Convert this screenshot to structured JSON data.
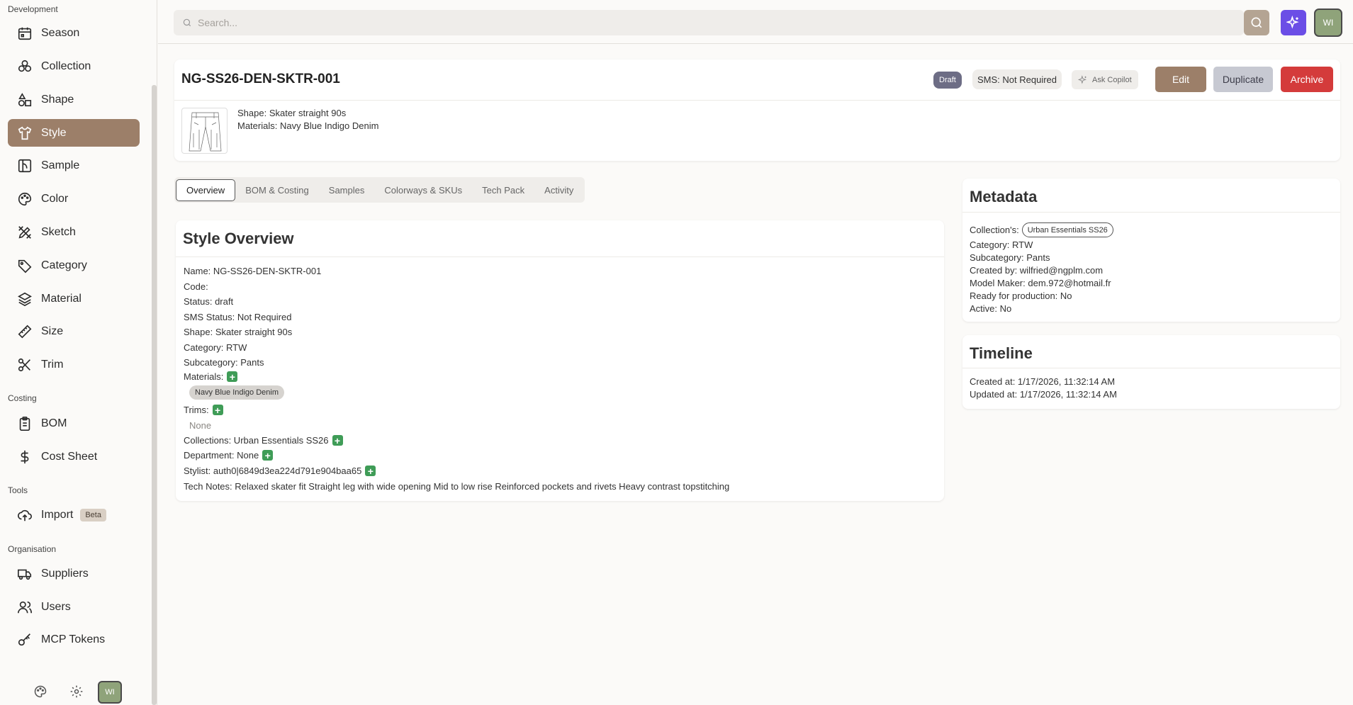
{
  "sidebar": {
    "sections": {
      "development": "Development",
      "costing": "Costing",
      "tools": "Tools",
      "organisation": "Organisation"
    },
    "items": [
      {
        "label": "Season",
        "icon": "calendar-icon"
      },
      {
        "label": "Collection",
        "icon": "collection-icon"
      },
      {
        "label": "Shape",
        "icon": "shapes-icon"
      },
      {
        "label": "Style",
        "icon": "shirt-icon",
        "active": true
      },
      {
        "label": "Sample",
        "icon": "sample-icon"
      },
      {
        "label": "Color",
        "icon": "palette-icon"
      },
      {
        "label": "Sketch",
        "icon": "sketch-icon"
      },
      {
        "label": "Category",
        "icon": "tag-icon"
      },
      {
        "label": "Material",
        "icon": "layers-icon"
      },
      {
        "label": "Size",
        "icon": "ruler-icon"
      },
      {
        "label": "Trim",
        "icon": "scissors-icon"
      },
      {
        "label": "BOM",
        "icon": "clipboard-icon"
      },
      {
        "label": "Cost Sheet",
        "icon": "dollar-icon"
      },
      {
        "label": "Import",
        "icon": "upload-cloud-icon",
        "badge": "Beta"
      },
      {
        "label": "Suppliers",
        "icon": "truck-icon"
      },
      {
        "label": "Users",
        "icon": "users-icon"
      },
      {
        "label": "MCP Tokens",
        "icon": "key-icon"
      }
    ],
    "avatar": "WI"
  },
  "topbar": {
    "search_placeholder": "Search...",
    "avatar": "WI"
  },
  "header": {
    "title": "NG-SS26-DEN-SKTR-001",
    "status_badge": "Draft",
    "sms_badge": "SMS: Not Required",
    "copilot_label": "Ask Copilot",
    "edit_label": "Edit",
    "duplicate_label": "Duplicate",
    "archive_label": "Archive",
    "shape_line": "Shape: Skater straight 90s",
    "materials_line": "Materials: Navy Blue Indigo Denim"
  },
  "tabs": [
    "Overview",
    "BOM & Costing",
    "Samples",
    "Colorways & SKUs",
    "Tech Pack",
    "Activity"
  ],
  "overview": {
    "title": "Style Overview",
    "name": "Name: NG-SS26-DEN-SKTR-001",
    "code": "Code:",
    "status": "Status: draft",
    "sms_status": "SMS Status: Not Required",
    "shape": "Shape: Skater straight 90s",
    "category": "Category: RTW",
    "subcategory": "Subcategory: Pants",
    "materials_label": "Materials:",
    "material_pill": "Navy Blue Indigo Denim",
    "trims_label": "Trims:",
    "trims_none": "None",
    "collections": "Collections: Urban Essentials SS26",
    "department": "Department: None",
    "stylist": "Stylist: auth0|6849d3ea224d791e904baa65",
    "tech_notes": "Tech Notes: Relaxed skater fit Straight leg with wide opening Mid to low rise Reinforced pockets and rivets Heavy contrast topstitching"
  },
  "metadata": {
    "title": "Metadata",
    "collection_label": "Collection's:",
    "collection_pill": "Urban Essentials SS26",
    "category": "Category: RTW",
    "subcategory": "Subcategory: Pants",
    "created_by": "Created by: wilfried@ngplm.com",
    "model_maker": "Model Maker: dem.972@hotmail.fr",
    "ready": "Ready for production: No",
    "active": "Active: No"
  },
  "timeline": {
    "title": "Timeline",
    "created": "Created at: 1/17/2026, 11:32:14 AM",
    "updated": "Updated at: 1/17/2026, 11:32:14 AM"
  },
  "colors": {
    "accent": "#9c7f69",
    "archive": "#d43b3b",
    "copilot": "#6b4ee6",
    "search_btn": "#b4a493",
    "plus": "#3f9c57"
  }
}
